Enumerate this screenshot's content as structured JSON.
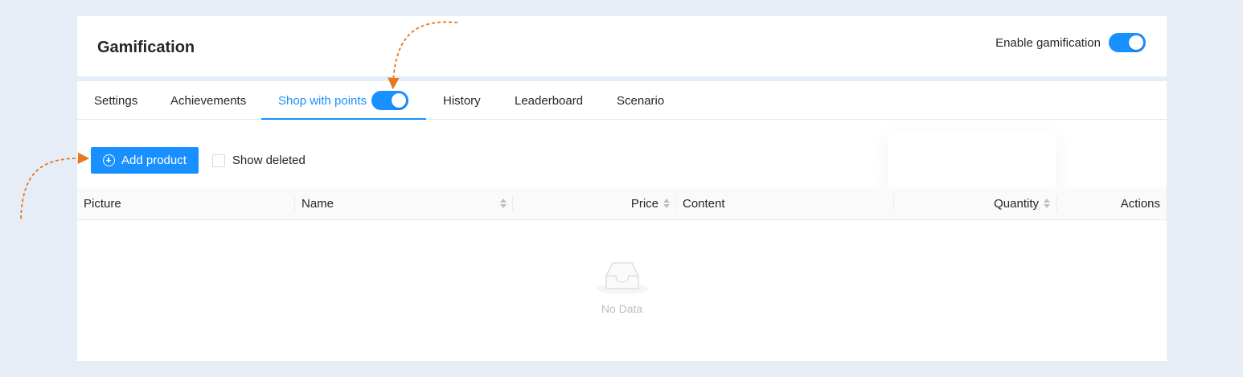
{
  "header": {
    "title": "Gamification",
    "enable_label": "Enable gamification",
    "enable_on": true
  },
  "tabs": [
    {
      "label": "Settings"
    },
    {
      "label": "Achievements"
    },
    {
      "label": "Shop with points",
      "active": true,
      "toggle_on": true
    },
    {
      "label": "History"
    },
    {
      "label": "Leaderboard"
    },
    {
      "label": "Scenario"
    }
  ],
  "toolbar": {
    "add_label": "Add product",
    "show_deleted_label": "Show deleted",
    "show_deleted_checked": false
  },
  "table": {
    "columns": [
      {
        "label": "Picture"
      },
      {
        "label": "Name",
        "sortable": true
      },
      {
        "label": "Price",
        "sortable": true
      },
      {
        "label": "Content"
      },
      {
        "label": "Quantity",
        "sortable": true
      },
      {
        "label": "Actions"
      }
    ],
    "empty_text": "No Data"
  },
  "colors": {
    "primary": "#1890ff",
    "annotation": "#e87722",
    "background": "#e6edf6"
  }
}
